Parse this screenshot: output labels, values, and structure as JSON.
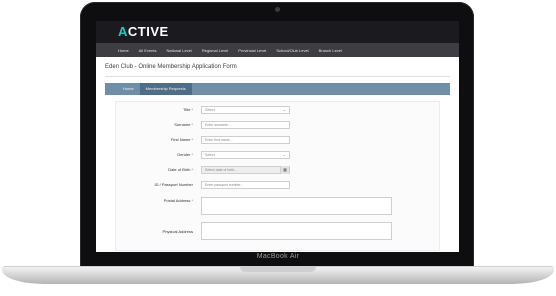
{
  "app": {
    "logo_text": "CTIVE",
    "logo_mark": "A"
  },
  "nav": {
    "items": [
      "Home",
      "All Events",
      "National Level",
      "Regional Level",
      "Provincial Level",
      "School/Club Level",
      "Branch Level"
    ]
  },
  "page": {
    "title": "Eden Club - Online Membership Application Form"
  },
  "breadcrumb": {
    "items": [
      "Home",
      "Membership Requests"
    ]
  },
  "form": {
    "title_label": "Title",
    "title_value": "Select",
    "surname_label": "Surname",
    "surname_placeholder": "Enter surname...",
    "first_name_label": "First Name",
    "first_name_placeholder": "Enter first name...",
    "gender_label": "Gender",
    "gender_value": "Select",
    "dob_label": "Date of Birth",
    "dob_placeholder": "Select date of birth...",
    "id_label": "ID / Passport Number",
    "id_placeholder": "Enter passport number...",
    "postal_label": "Postal Address",
    "physical_label": "Physical Address",
    "required_mark": "*"
  },
  "device": {
    "model": "MacBook Air"
  },
  "colors": {
    "accent": "#25c6c6",
    "breadcrumb_bg": "#6f8fa8",
    "nav_bg": "#3d3d42",
    "required": "#d9534f"
  },
  "icons": {
    "select_chevron": "chevron-down-icon",
    "calendar": "calendar-icon"
  }
}
